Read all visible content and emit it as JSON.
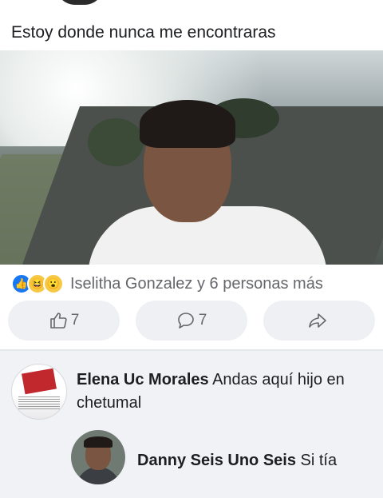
{
  "post": {
    "caption": "Estoy donde nunca me encontraras"
  },
  "reactions": {
    "icons": [
      "like-icon",
      "haha-icon",
      "wow-icon"
    ],
    "summary": "Iselitha Gonzalez y 6 personas más"
  },
  "actions": {
    "like_count": "7",
    "comment_count": "7"
  },
  "comments": [
    {
      "author": "Elena Uc Morales",
      "text": "Andas aquí hijo en chetumal"
    },
    {
      "author": "Danny Seis Uno Seis",
      "text": "Si tía"
    }
  ],
  "colors": {
    "like_blue": "#1877f2",
    "secondary_text": "#65676b",
    "pill_bg": "#eef0f3",
    "comment_bg": "#f0f2f5"
  }
}
